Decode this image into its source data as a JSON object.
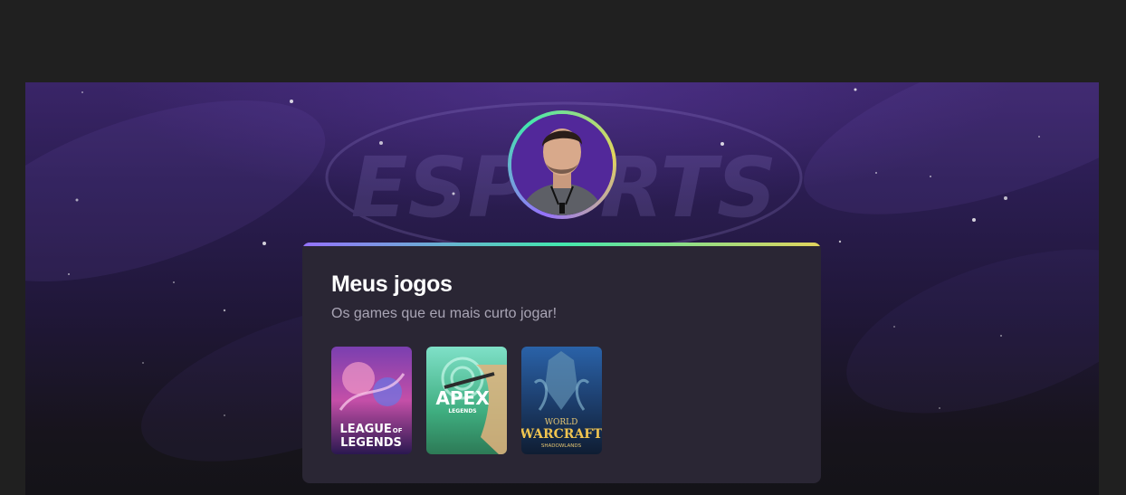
{
  "page": {
    "background_color": "#202020",
    "hero_background": [
      "#3a2568",
      "#17141c"
    ],
    "accent_gradient": [
      "#9572fc",
      "#43e7ad",
      "#e2d45c"
    ]
  },
  "hero": {
    "background_watermark": "ESPORTS"
  },
  "profile": {
    "avatar_icon": "person-photo"
  },
  "games_card": {
    "title": "Meus jogos",
    "subtitle": "Os games que eu mais curto jogar!",
    "games": [
      {
        "logo_line1": "LEAGUE",
        "logo_of": "OF",
        "logo_line2": "LEGENDS"
      },
      {
        "logo_line1": "APEX",
        "logo_line2": "LEGENDS"
      },
      {
        "logo_line1": "WORLD",
        "logo_line2": "WARCRAFT",
        "logo_line3": "SHADOWLANDS"
      }
    ]
  }
}
